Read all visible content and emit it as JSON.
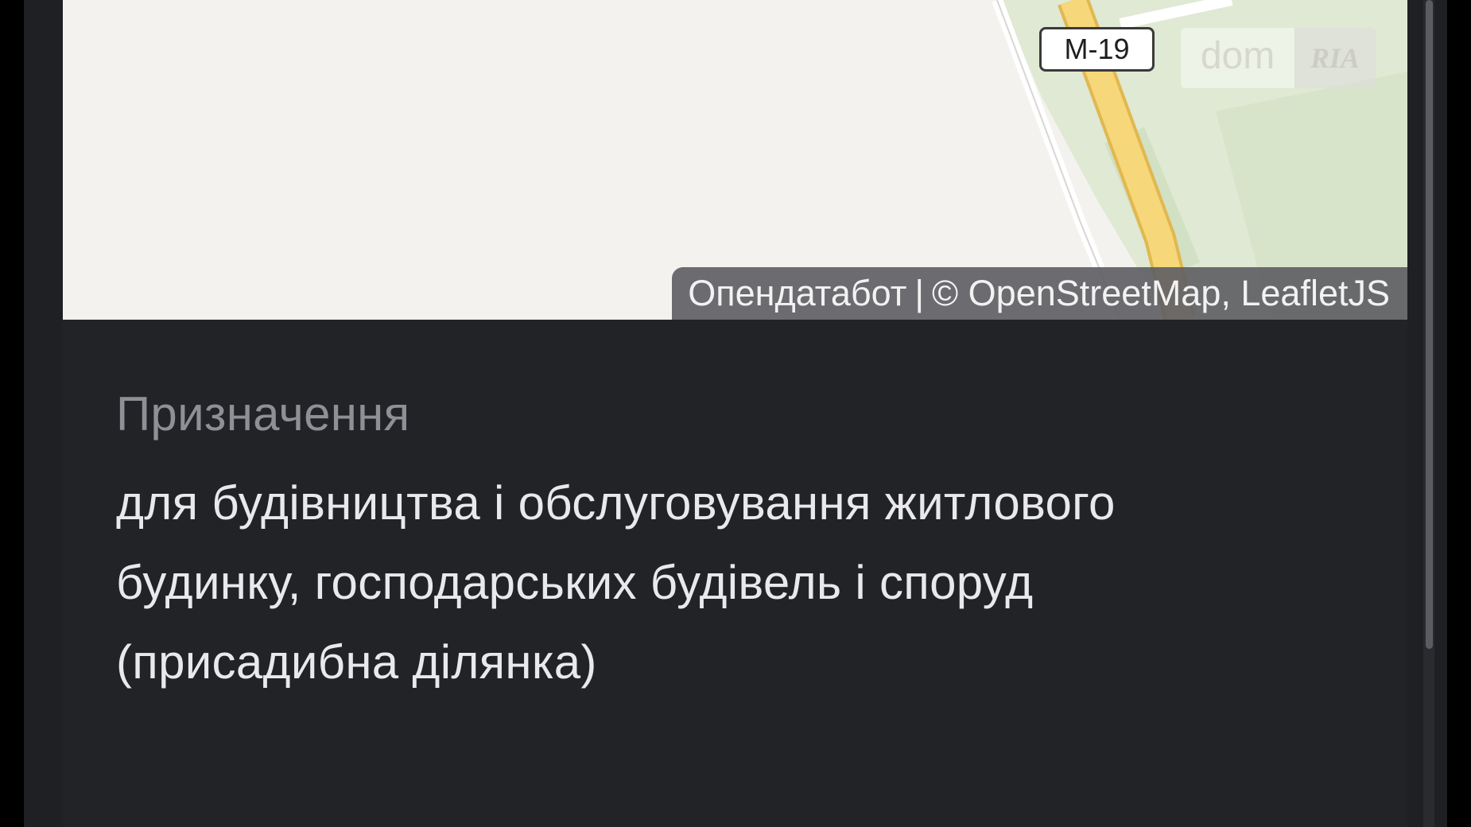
{
  "map": {
    "road_label": "M-19",
    "attribution": {
      "provider": "Опендатабот",
      "separator": "|",
      "credits": "© OpenStreetMap, LeafletJS"
    },
    "watermark": {
      "left": "dom",
      "right": "RIA"
    }
  },
  "details": {
    "purpose_label": "Призначення",
    "purpose_lines": [
      "для будівництва і обслуговування житлового",
      "будинку, господарських будівель і споруд",
      "(присадибна ділянка)"
    ]
  },
  "colors": {
    "background": "#000000",
    "panel": "#222327",
    "label_text": "#8f9096",
    "value_text": "#e9e9eb",
    "map_land": "#f4f2ee",
    "map_green": "#dfe9d3",
    "map_highway": "#f6d77a"
  }
}
